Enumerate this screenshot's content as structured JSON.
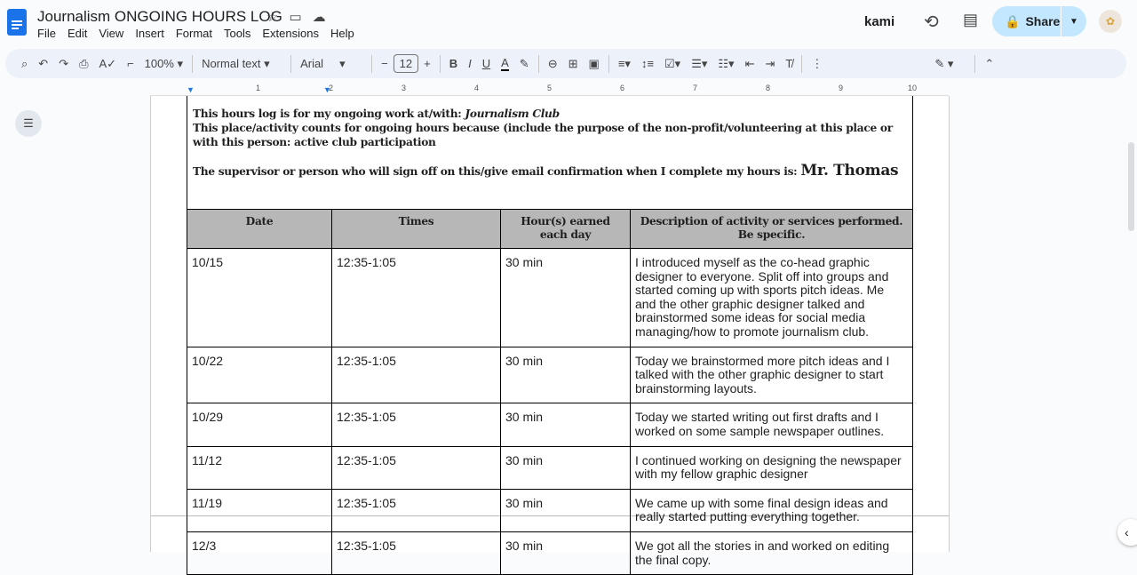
{
  "header": {
    "title": "Journalism ONGOING HOURS LOG",
    "menu": [
      "File",
      "Edit",
      "View",
      "Insert",
      "Format",
      "Tools",
      "Extensions",
      "Help"
    ],
    "kami": "kami",
    "share": "Share"
  },
  "toolbar": {
    "zoom": "100%",
    "style": "Normal text",
    "font": "Arial",
    "font_size": "12"
  },
  "ruler": [
    "1",
    "2",
    "3",
    "4",
    "5",
    "6",
    "7",
    "8",
    "9",
    "10"
  ],
  "intro": {
    "line1": "This hours log is for my ongoing work at/with: ",
    "club": "Journalism Club",
    "line2": "This place/activity counts for ongoing hours because (include the purpose of the non-profit/volunteering at this place or with this person: active club participation",
    "line3": "The supervisor or person who will sign off on this/give email confirmation when I complete my hours is: ",
    "supervisor": "Mr. Thomas"
  },
  "table": {
    "headers": [
      "Date",
      "Times",
      "Hour(s) earned each day",
      "Description of activity or services performed. Be specific."
    ],
    "rows": [
      [
        "10/15",
        "12:35-1:05",
        "30 min",
        "I introduced myself as the co-head graphic designer to everyone. Split off into groups and started coming up with sports pitch ideas. Me and the other graphic designer talked and brainstormed some ideas for social media managing/how to promote journalism club."
      ],
      [
        "10/22",
        "12:35-1:05",
        "30 min",
        "Today we brainstormed more pitch ideas and I talked with the other graphic designer to start brainstorming layouts."
      ],
      [
        "10/29",
        "12:35-1:05",
        "30 min",
        "Today we started writing out first drafts and I worked on some sample newspaper outlines."
      ],
      [
        "11/12",
        "12:35-1:05",
        "30 min",
        "I continued working on designing the newspaper with my fellow graphic designer"
      ],
      [
        "11/19",
        "12:35-1:05",
        "30 min",
        "We came up with some final design ideas and really started putting everything together."
      ],
      [
        "12/3",
        "12:35-1:05",
        "30 min",
        "We got all the stories in and worked on editing the final copy."
      ]
    ]
  }
}
